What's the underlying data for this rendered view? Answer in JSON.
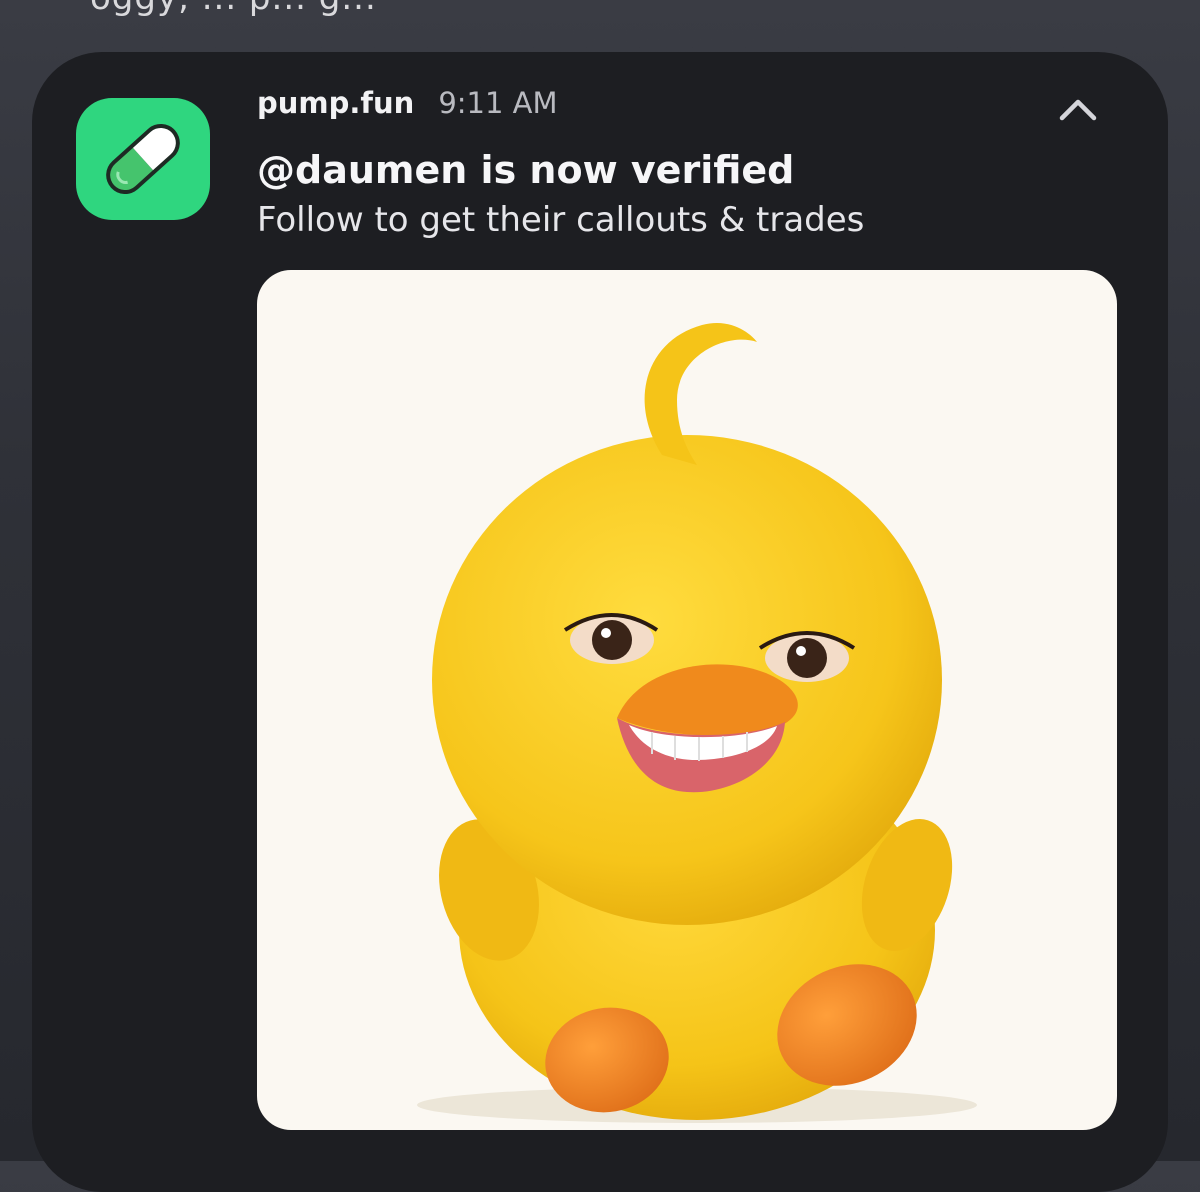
{
  "background_text": "oggy, ... p... g...",
  "notification": {
    "app_name": "pump.fun",
    "time": "9:11 AM",
    "title": "@daumen is now verified",
    "body": "Follow to get their callouts & trades",
    "app_icon": "pill-capsule-icon",
    "collapse_icon": "chevron-up-icon",
    "image": "yellow-chick-with-human-face-image",
    "colors": {
      "card_bg": "#1d1e22",
      "icon_bg": "#2fd67f",
      "chick_yellow": "#f5c418",
      "beak_orange": "#f08a1c"
    }
  }
}
